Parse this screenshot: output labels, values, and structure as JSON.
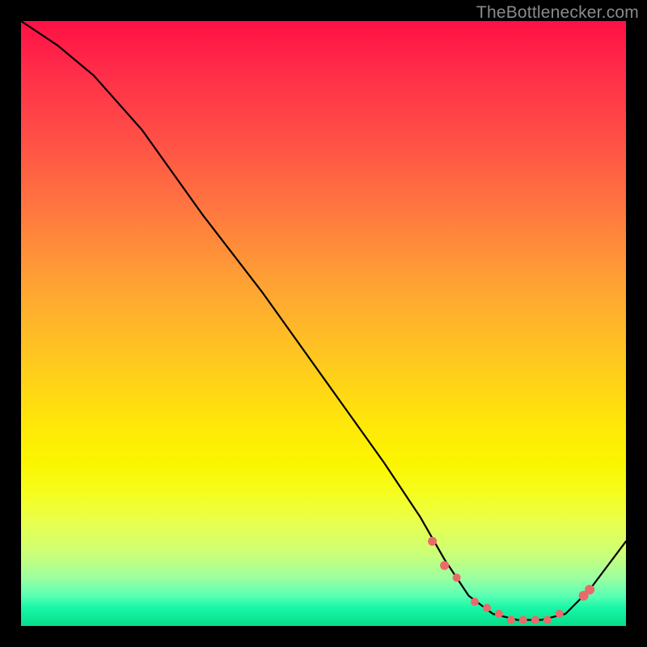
{
  "watermark": "TheBottlenecker.com",
  "colors": {
    "frame_bg": "#000000",
    "marker": "#e96a6a",
    "curve": "#000000"
  },
  "chart_data": {
    "type": "line",
    "title": "",
    "xlabel": "",
    "ylabel": "",
    "xlim": [
      0,
      100
    ],
    "ylim": [
      0,
      100
    ],
    "grid": false,
    "legend": false,
    "series": [
      {
        "name": "bottleneck-curve",
        "x": [
          0,
          6,
          12,
          20,
          30,
          40,
          50,
          60,
          66,
          70,
          74,
          78,
          82,
          86,
          90,
          94,
          100
        ],
        "y": [
          100,
          96,
          91,
          82,
          68,
          55,
          41,
          27,
          18,
          11,
          5,
          2,
          1,
          1,
          2,
          6,
          14
        ]
      }
    ],
    "markers": {
      "name": "highlight-points",
      "x": [
        68,
        70,
        72,
        75,
        77,
        79,
        81,
        83,
        85,
        87,
        89,
        93,
        94
      ],
      "y": [
        14,
        10,
        8,
        4,
        3,
        2,
        1,
        1,
        1,
        1,
        2,
        5,
        6
      ],
      "r": [
        5.5,
        5.5,
        5,
        5,
        5,
        5,
        5,
        5,
        5,
        5,
        5,
        6,
        6
      ]
    }
  }
}
